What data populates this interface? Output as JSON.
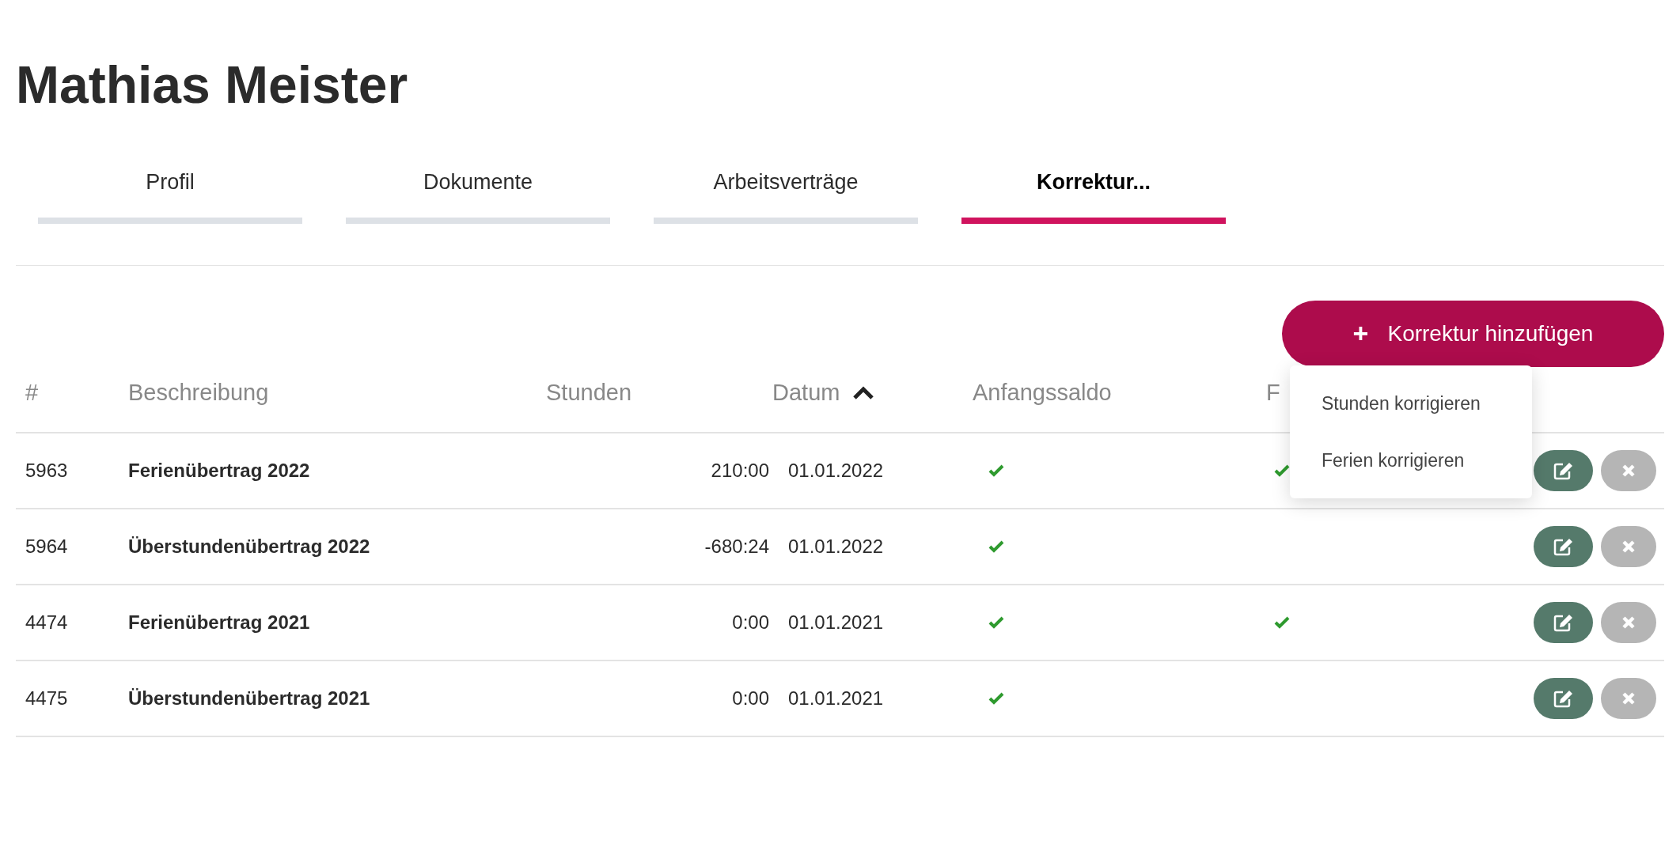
{
  "title": "Mathias Meister",
  "tabs": [
    {
      "label": "Profil",
      "selected": false
    },
    {
      "label": "Dokumente",
      "selected": false
    },
    {
      "label": "Arbeitsverträge",
      "selected": false
    },
    {
      "label": "Korrektur...",
      "selected": true
    }
  ],
  "add_button": {
    "icon": "+",
    "label": "Korrektur hinzufügen"
  },
  "menu": {
    "items": [
      "Stunden korrigieren",
      "Ferien korrigieren"
    ]
  },
  "table": {
    "columns": [
      "#",
      "Beschreibung",
      "Stunden",
      "Datum",
      "Anfangssaldo",
      "F"
    ],
    "sort_ascending": true,
    "rows": [
      {
        "id": "5963",
        "description": "Ferienübertrag 2022",
        "hours": "210:00",
        "date": "01.01.2022",
        "anfangssaldo": true,
        "column_6": true
      },
      {
        "id": "5964",
        "description": "Überstundenübertrag 2022",
        "hours": "-680:24",
        "date": "01.01.2022",
        "anfangssaldo": true,
        "column_6": false
      },
      {
        "id": "4474",
        "description": "Ferienübertrag 2021",
        "hours": "0:00",
        "date": "01.01.2021",
        "anfangssaldo": true,
        "column_6": true
      },
      {
        "id": "4475",
        "description": "Überstundenübertrag 2021",
        "hours": "0:00",
        "date": "01.01.2021",
        "anfangssaldo": true,
        "column_6": false
      }
    ]
  }
}
